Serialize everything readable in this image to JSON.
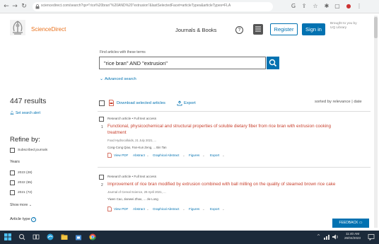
{
  "browser": {
    "url": "sciencedirect.com/search?qs=\"rice%20bran\"%20AND%20\"extrusion\"&lastSelectedFacet=articleTypes&articleTypes=FLA"
  },
  "header": {
    "brand": "ScienceDirect",
    "journals_books": "Journals & Books",
    "register": "Register",
    "sign_in": "Sign in",
    "brought_by": "Brought to you by UQ Library"
  },
  "search": {
    "label": "Find articles with these terms",
    "value": "\"rice bran\" AND \"extrusion\"",
    "advanced": "Advanced search"
  },
  "sidebar": {
    "results_count": "447 results",
    "set_alert": "Set search alert",
    "refine_by": "Refine by:",
    "subscribed": "Subscribed journals",
    "years_heading": "Years",
    "years": [
      {
        "label": "2023 (28)"
      },
      {
        "label": "2022 (55)"
      },
      {
        "label": "2021 (72)"
      }
    ],
    "show_more": "Show more",
    "article_type": "Article type"
  },
  "toolbar": {
    "download": "Download selected articles",
    "export": "Export",
    "sorted_by": "sorted by relevance | date"
  },
  "results": [
    {
      "meta": "Research article  •  Full text access",
      "number": "1",
      "title_line1": "Functional, physicochemical and structural properties of soluble dietary fiber from rice bran with extrusion cooking",
      "title_line2": "treatment",
      "journal": "Food Hydrocolloids, 21 July 2021, ...",
      "authors": "Cong-Cong Qiao, Fan-Kun Zeng, ... Bin Tan",
      "actions": [
        "View PDF",
        "Abstract",
        "Graphical Abstract",
        "Figures",
        "Export"
      ]
    },
    {
      "meta": "Research article  •  Full text access",
      "number": "2",
      "title_line1": "Improvement of rice bran modified by extrusion combined with ball milling on the quality of steamed brown rice cake",
      "title_line2": "",
      "journal": "Journal of Cereal Science, 29 April 2021, ...",
      "authors": "Yiwen Cao, Jianwei Zhao, ... Jie Long",
      "actions": [
        "View PDF",
        "Abstract",
        "Graphical Abstract",
        "Figures",
        "Export"
      ]
    }
  ],
  "feedback": "FEEDBACK",
  "taskbar": {
    "time": "11:40 AM",
    "date": "26/04/2023"
  },
  "colors": {
    "brand_orange": "#e9711c",
    "link_blue": "#0272b1",
    "title_red": "#c8412e",
    "taskbar": "#1c2a3a"
  }
}
